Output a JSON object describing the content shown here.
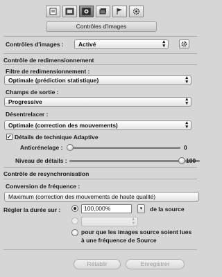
{
  "toolbar": {
    "tabs": [
      {
        "icon": "document-icon"
      },
      {
        "icon": "filmstrip-icon"
      },
      {
        "icon": "image-controls-icon",
        "active": true
      },
      {
        "icon": "stack-icon"
      },
      {
        "icon": "flag-icon"
      },
      {
        "icon": "gear-icon"
      }
    ],
    "section_title": "Contrôles d'images"
  },
  "image_controls": {
    "label": "Contrôles d'images :",
    "value": "Activé"
  },
  "resize": {
    "heading": "Contrôle de redimensionnement",
    "filter_label": "Filtre de redimensionnement :",
    "filter_value": "Optimale (prédiction statistique)",
    "output_label": "Champs de sortie :",
    "output_value": "Progressive",
    "deinterlace_label": "Désentrelacer :",
    "deinterlace_value": "Optimale (correction des mouvements)",
    "adaptive_label": "Détails de technique Adaptive",
    "adaptive_checked": true,
    "antialias_label": "Anticrénelage :",
    "antialias_value": "0",
    "detail_label": "Niveau de détails :",
    "detail_value": "100"
  },
  "resync": {
    "heading": "Contrôle de resynchronisation",
    "frame_conversion_label": "Conversion de fréquence :",
    "frame_conversion_value": "Maximum (correction des mouvements de haute qualité)",
    "duration_label": "Régler la durée sur :",
    "duration_value": "100,000%",
    "duration_suffix": "de la source",
    "source_rate_text": "pour que les images source soient lues à une fréquence de Source"
  },
  "buttons": {
    "reset": "Rétablir",
    "save": "Enregistrer"
  }
}
